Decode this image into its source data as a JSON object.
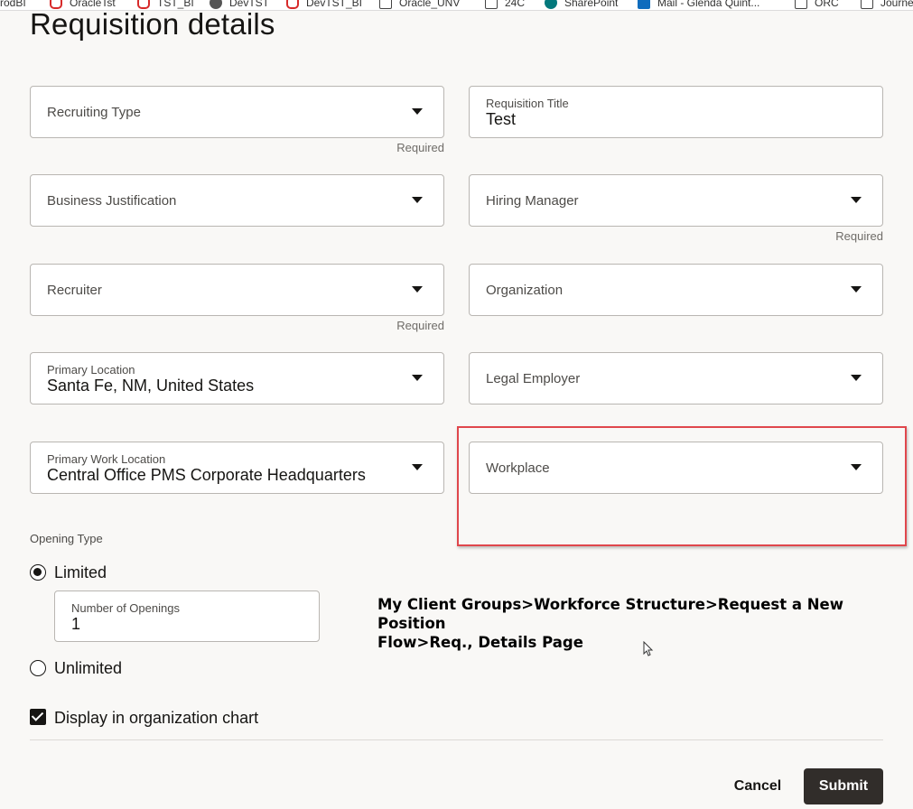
{
  "bookmarks": [
    {
      "label": "ProdBI",
      "icon": "none"
    },
    {
      "label": "OracleTst",
      "icon": "oracle-icon"
    },
    {
      "label": "TST_BI",
      "icon": "oracle-icon"
    },
    {
      "label": "DevTST",
      "icon": "globe-icon"
    },
    {
      "label": "DevTST_BI",
      "icon": "oracle-icon"
    },
    {
      "label": "Oracle_UNV",
      "icon": "folder-icon"
    },
    {
      "label": "24C",
      "icon": "folder-icon"
    },
    {
      "label": "SharePoint",
      "icon": "sharepoint-icon"
    },
    {
      "label": "Mail - Glenda Quint...",
      "icon": "outlook-icon"
    },
    {
      "label": "ORC",
      "icon": "folder-icon"
    },
    {
      "label": "Journe",
      "icon": "folder-icon"
    }
  ],
  "page": {
    "title": "Requisition details"
  },
  "fields": {
    "recruiting_type": {
      "label": "Recruiting Type",
      "required": "Required"
    },
    "requisition_title": {
      "label": "Requisition Title",
      "value": "Test"
    },
    "business_justification": {
      "label": "Business Justification"
    },
    "hiring_manager": {
      "label": "Hiring Manager",
      "required": "Required"
    },
    "recruiter": {
      "label": "Recruiter",
      "required": "Required"
    },
    "organization": {
      "label": "Organization"
    },
    "primary_location": {
      "label": "Primary Location",
      "value": "Santa Fe, NM, United States"
    },
    "legal_employer": {
      "label": "Legal Employer"
    },
    "primary_work_location": {
      "label": "Primary Work Location",
      "value": "Central Office PMS Corporate Headquarters"
    },
    "workplace": {
      "label": "Workplace"
    }
  },
  "opening_type": {
    "label": "Opening Type",
    "limited": "Limited",
    "number_of_openings_label": "Number of Openings",
    "number_of_openings_value": "1",
    "unlimited": "Unlimited",
    "selected": "Limited"
  },
  "org_chart": {
    "label": "Display in organization chart",
    "checked": true
  },
  "annotation": {
    "line1": "My Client Groups>Workforce Structure>Request a New Position",
    "line2": "Flow>Req., Details Page"
  },
  "footer": {
    "cancel": "Cancel",
    "submit": "Submit"
  },
  "colors": {
    "highlight_border": "#e0474c",
    "submit_bg": "#312d2a",
    "page_bg": "#f9f8f6"
  }
}
